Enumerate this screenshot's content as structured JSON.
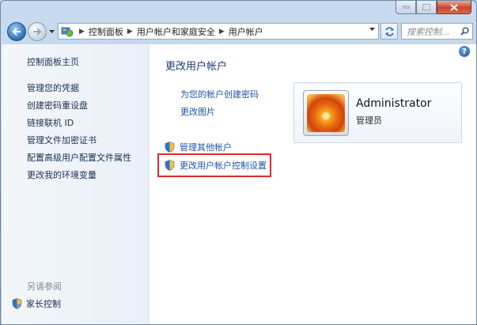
{
  "window": {
    "controls": [
      "minimize-icon",
      "maximize-icon",
      "close-icon"
    ]
  },
  "addressbar": {
    "breadcrumbs": [
      "控制面板",
      "用户帐户和家庭安全",
      "用户帐户"
    ],
    "search_placeholder": "搜索控制...",
    "icons": [
      "back-arrow-icon",
      "forward-arrow-icon",
      "control-panel-icon",
      "refresh-icon",
      "search-icon"
    ]
  },
  "sidebar": {
    "home": "控制面板主页",
    "items": [
      "管理您的凭据",
      "创建密码重设盘",
      "链接联机 ID",
      "管理文件加密证书",
      "配置高级用户配置文件属性",
      "更改我的环境变量"
    ],
    "see_also_label": "另请参阅",
    "see_also_item": "家长控制"
  },
  "main": {
    "title": "更改用户帐户",
    "links": [
      "为您的帐户创建密码",
      "更改图片"
    ],
    "shield_links": [
      "管理其他帐户",
      "更改用户帐户控制设置"
    ],
    "highlight_color": "#e0282e"
  },
  "user": {
    "name": "Administrator",
    "role": "管理员"
  }
}
